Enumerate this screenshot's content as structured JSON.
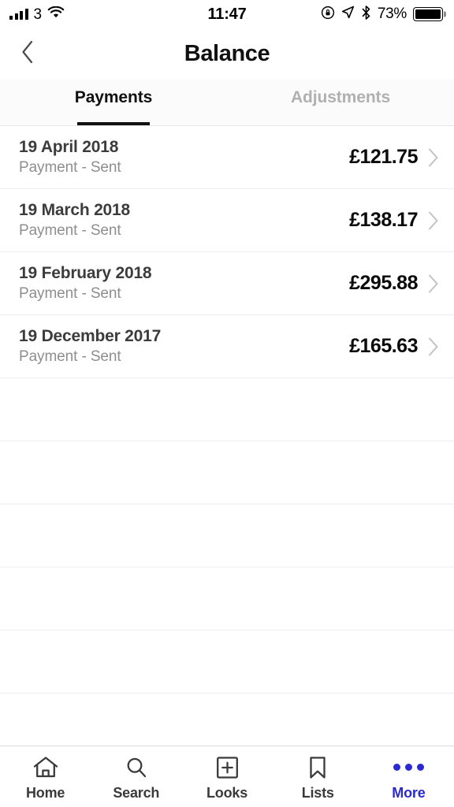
{
  "status_bar": {
    "carrier": "3",
    "time": "11:47",
    "battery_percent": "73%",
    "icons": [
      "signal-bars-icon",
      "wifi-icon",
      "rotation-lock-icon",
      "location-arrow-icon",
      "bluetooth-icon",
      "battery-icon"
    ]
  },
  "header": {
    "title": "Balance",
    "back_icon": "chevron-left-icon"
  },
  "tabs": [
    {
      "label": "Payments",
      "active": true
    },
    {
      "label": "Adjustments",
      "active": false
    }
  ],
  "transactions": [
    {
      "date": "19 April 2018",
      "status": "Payment - Sent",
      "amount": "£121.75"
    },
    {
      "date": "19 March 2018",
      "status": "Payment - Sent",
      "amount": "£138.17"
    },
    {
      "date": "19 February 2018",
      "status": "Payment - Sent",
      "amount": "£295.88"
    },
    {
      "date": "19 December 2017",
      "status": "Payment - Sent",
      "amount": "£165.63"
    }
  ],
  "empty_rows": 6,
  "bottom_nav": [
    {
      "label": "Home",
      "icon": "home-icon",
      "active": false
    },
    {
      "label": "Search",
      "icon": "search-icon",
      "active": false
    },
    {
      "label": "Looks",
      "icon": "plus-box-icon",
      "active": false
    },
    {
      "label": "Lists",
      "icon": "bookmark-icon",
      "active": false
    },
    {
      "label": "More",
      "icon": "ellipsis-icon",
      "active": true
    }
  ],
  "colors": {
    "accent": "#2a2ad0",
    "text_primary": "#111111",
    "text_secondary": "#8e8e8e",
    "divider": "#ededed"
  }
}
